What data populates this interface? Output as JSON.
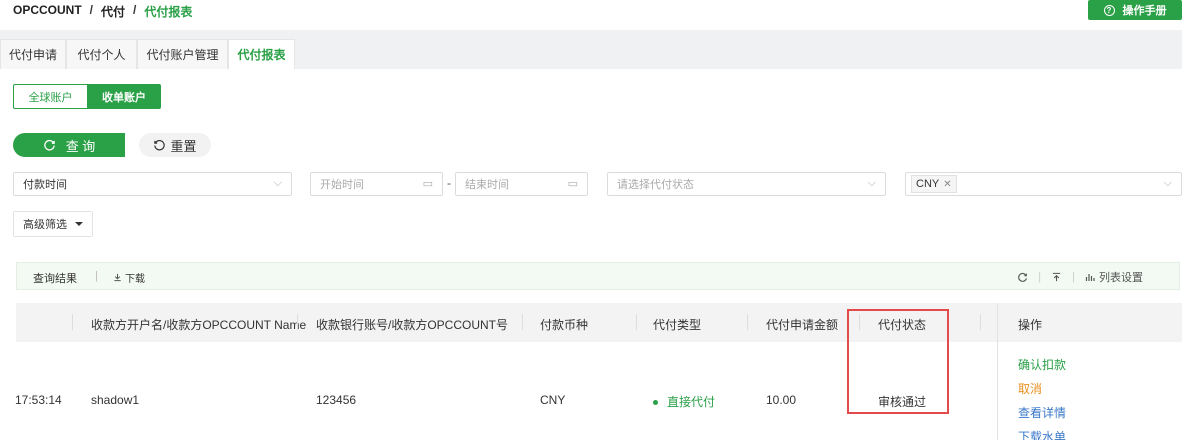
{
  "breadcrumb": {
    "root": "OPCCOUNT",
    "sep": "/",
    "level1": "代付",
    "current": "代付报表"
  },
  "header": {
    "manual_label": "操作手册",
    "manual_icon": "help-circle-icon"
  },
  "tabs": [
    {
      "label": "代付申请",
      "active": false
    },
    {
      "label": "代付个人",
      "active": false
    },
    {
      "label": "代付账户管理",
      "active": false
    },
    {
      "label": "代付报表",
      "active": true
    }
  ],
  "account_switch": {
    "global": "全球账户",
    "collect": "收单账户",
    "selected": "收单账户"
  },
  "actions": {
    "query_label": "查 询",
    "reset_label": "重置"
  },
  "filters": {
    "time_type": "付款时间",
    "start_placeholder": "开始时间",
    "range_sep": "-",
    "end_placeholder": "结束时间",
    "status_placeholder": "请选择代付状态",
    "currency_tag": "CNY",
    "advanced_label": "高级筛选"
  },
  "result_bar": {
    "label": "查询结果",
    "download": "下载",
    "column_settings": "列表设置"
  },
  "table": {
    "columns": [
      "收款方开户名/收款方OPCCOUNT Name",
      "收款银行账号/收款方OPCCOUNT号",
      "付款币种",
      "代付类型",
      "代付申请金额",
      "代付状态"
    ],
    "operation_header": "操作",
    "rows": [
      {
        "time": "17:53:14",
        "name": "shadow1",
        "account": "123456",
        "currency": "CNY",
        "type": "直接代付",
        "amount": "10.00",
        "status": "审核通过",
        "ops": [
          "确认扣款",
          "取消",
          "查看详情",
          "下载水单"
        ]
      }
    ]
  },
  "colors": {
    "accent": "#2aa047",
    "warning": "#e8901c",
    "link": "#3a78c9",
    "highlight": "#e44a4a"
  }
}
